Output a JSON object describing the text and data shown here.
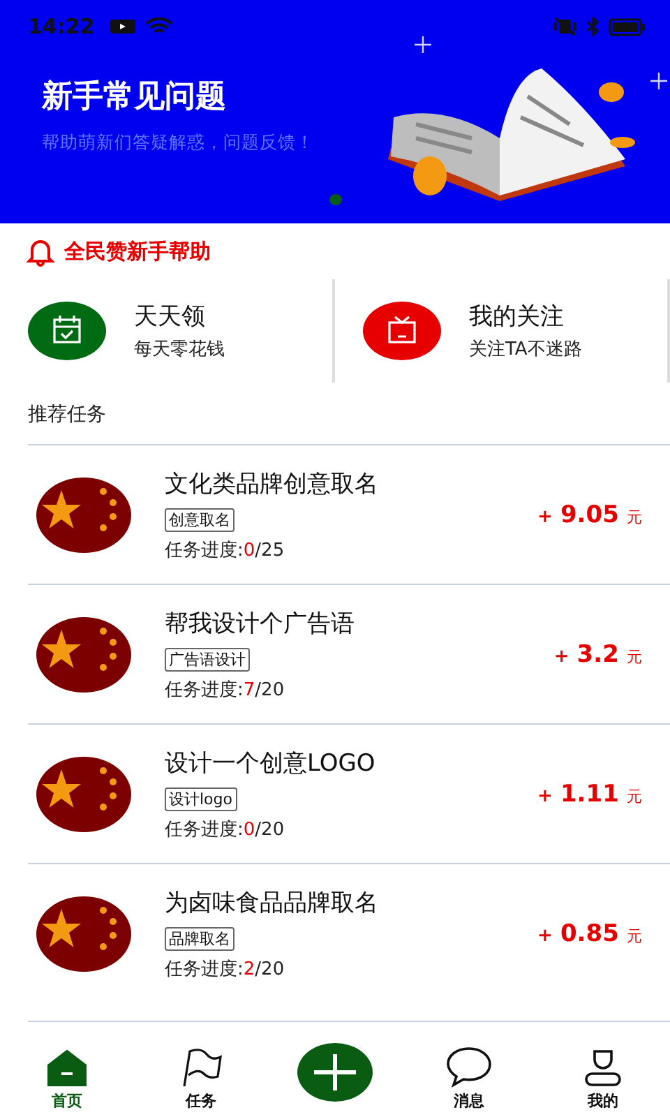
{
  "status_bar": {
    "time": "14:22"
  },
  "banner": {
    "title": "新手常见问题",
    "subtitle": "帮助萌新们答疑解惑，问题反馈！",
    "dots": [
      {
        "selected": true
      }
    ]
  },
  "notice": {
    "text": "全民赞新手帮助"
  },
  "shortcuts": [
    {
      "kind": "calendar",
      "title": "天天领",
      "subtitle": "每天零花钱",
      "color": "#006b12"
    },
    {
      "kind": "gift",
      "title": "我的关注",
      "subtitle": "关注TA不迷路",
      "color": "#e60000"
    }
  ],
  "section_title": "推荐任务",
  "tasks": [
    {
      "title": "文化类品牌创意取名",
      "tag": "创意取名",
      "progress_label": "任务进度:",
      "done": "0",
      "total": "/25",
      "plus": "+",
      "reward": "9.05",
      "unit": "元"
    },
    {
      "title": "帮我设计个广告语",
      "tag": "广告语设计",
      "progress_label": "任务进度:",
      "done": "7",
      "total": "/20",
      "plus": "+",
      "reward": "3.2",
      "unit": "元"
    },
    {
      "title": "设计一个创意LOGO",
      "tag": "设计logo",
      "progress_label": "任务进度:",
      "done": "0",
      "total": "/20",
      "plus": "+",
      "reward": "1.11",
      "unit": "元"
    },
    {
      "title": "为卤味食品品牌取名",
      "tag": "品牌取名",
      "progress_label": "任务进度:",
      "done": "2",
      "total": "/20",
      "plus": "+",
      "reward": "0.85",
      "unit": "元"
    }
  ],
  "nav": [
    {
      "kind": "home",
      "label": "首页",
      "selected": true
    },
    {
      "kind": "flag",
      "label": "任务",
      "selected": false
    },
    {
      "kind": "add",
      "selected": false
    },
    {
      "kind": "chat",
      "label": "消息",
      "selected": false
    },
    {
      "kind": "user",
      "label": "我的",
      "selected": false
    }
  ]
}
